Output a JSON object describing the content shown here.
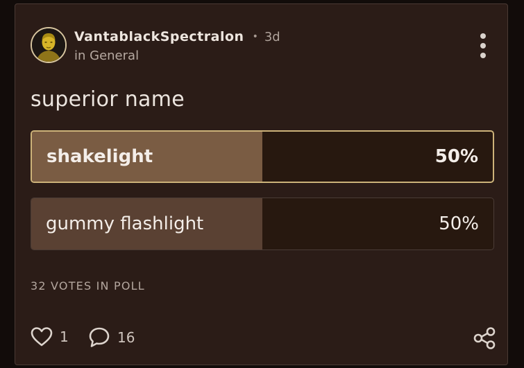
{
  "post": {
    "author": "VantablackSpectralon",
    "separator": "•",
    "age": "3d",
    "community": "in General",
    "title": "superior name",
    "avatar_icon": "golden-statue-bust"
  },
  "poll": {
    "options": [
      {
        "label": "shakelight",
        "percent_text": "50%",
        "percent": 50,
        "selected": true
      },
      {
        "label": "gummy flashlight",
        "percent_text": "50%",
        "percent": 50,
        "selected": false
      }
    ],
    "votes_label": "32 VOTES IN POLL"
  },
  "actions": {
    "likes": "1",
    "comments": "16",
    "like_icon": "heart-icon",
    "comment_icon": "comment-bubble-icon",
    "share_icon": "share-icon",
    "more_icon": "more-vertical-icon"
  },
  "colors": {
    "card_bg": "#2b1c17",
    "selected_fill": "#7a5c43",
    "unselected_fill": "#5a4133",
    "selected_border": "#cdb37a",
    "text_primary": "#f4eee9"
  }
}
